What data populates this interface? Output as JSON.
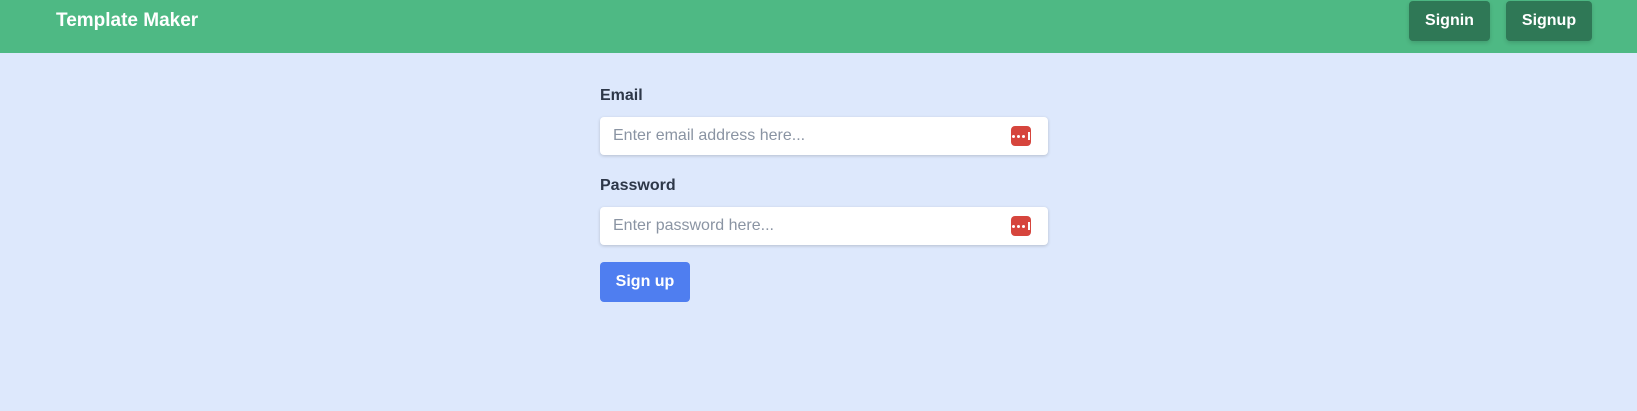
{
  "header": {
    "brand": "Template Maker",
    "signin_label": "Signin",
    "signup_label": "Signup"
  },
  "form": {
    "email": {
      "label": "Email",
      "placeholder": "Enter email address here...",
      "value": ""
    },
    "password": {
      "label": "Password",
      "placeholder": "Enter password here...",
      "value": ""
    },
    "submit_label": "Sign up"
  },
  "icons": {
    "password_manager": "password-manager-icon"
  },
  "colors": {
    "navbar": "#4eb984",
    "nav_button": "#2f7856",
    "page_background": "#dde8fc",
    "submit_button": "#4f7ef0",
    "password_manager_icon": "#d6453d"
  }
}
